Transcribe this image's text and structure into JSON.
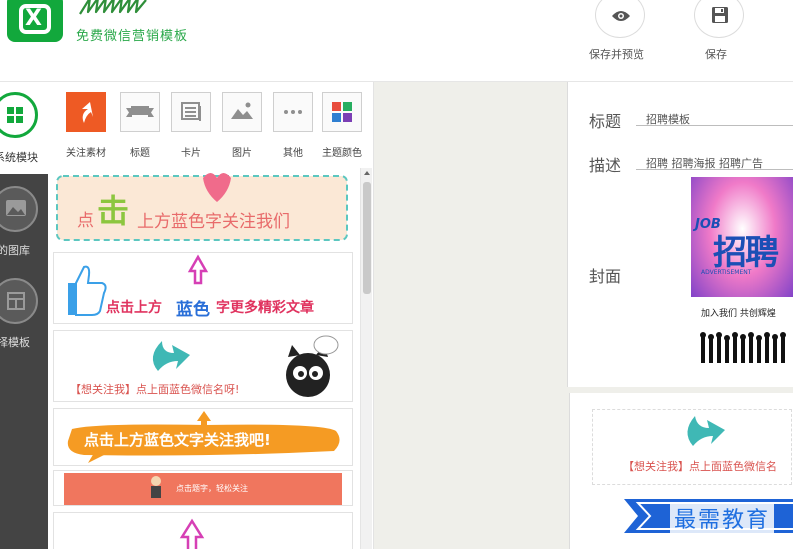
{
  "brand": {
    "subtitle": "免费微信营销模板"
  },
  "header_actions": [
    {
      "id": "save-preview",
      "label": "保存并预览",
      "icon": "eye-icon"
    },
    {
      "id": "save",
      "label": "保存",
      "icon": "floppy-disk-icon"
    }
  ],
  "rail": [
    {
      "label": "系统模块",
      "icon": "grid-icon",
      "active": true
    },
    {
      "label": "我的图库",
      "icon": "picture-icon",
      "active": false
    },
    {
      "label": "选择模板",
      "icon": "template-icon",
      "active": false
    }
  ],
  "tools": [
    {
      "label": "关注素材",
      "icon": "curved-arrow-icon",
      "active": true
    },
    {
      "label": "标题",
      "icon": "ribbon-icon",
      "active": false
    },
    {
      "label": "卡片",
      "icon": "card-icon",
      "active": false
    },
    {
      "label": "图片",
      "icon": "image-icon",
      "active": false
    },
    {
      "label": "其他",
      "icon": "more-icon",
      "active": false
    },
    {
      "label": "主题颜色",
      "icon": "palette-icon",
      "active": false
    }
  ],
  "materials": [
    {
      "text_a": "点",
      "text_b": "击",
      "text_c": "上方蓝色字关注我们"
    },
    {
      "text_a": "点击上方",
      "text_b": "蓝色",
      "text_c": "字更多精彩文章"
    },
    {
      "text": "【想关注我】点上面蓝色微信名呀!"
    },
    {
      "text": "点击上方蓝色文字关注我吧!"
    },
    {
      "text": "点击题字，轻松关注"
    }
  ],
  "meta": {
    "title_label": "标题",
    "title_value": "招聘模板",
    "desc_label": "描述",
    "desc_value": "招聘 招聘海报 招聘广告",
    "cover_label": "封面"
  },
  "cover": {
    "line1": "JOB",
    "line2": "招聘",
    "line3": "ADVERTISEMENT",
    "line4": "加入我们 共创辉煌"
  },
  "preview": {
    "text": "【想关注我】点上面蓝色微信名"
  },
  "watermark": "最需教育",
  "colors": {
    "brand_green": "#12a83c",
    "accent_orange": "#ee5a24",
    "rail_dark": "#444444",
    "canvas_gray": "#efefea"
  }
}
